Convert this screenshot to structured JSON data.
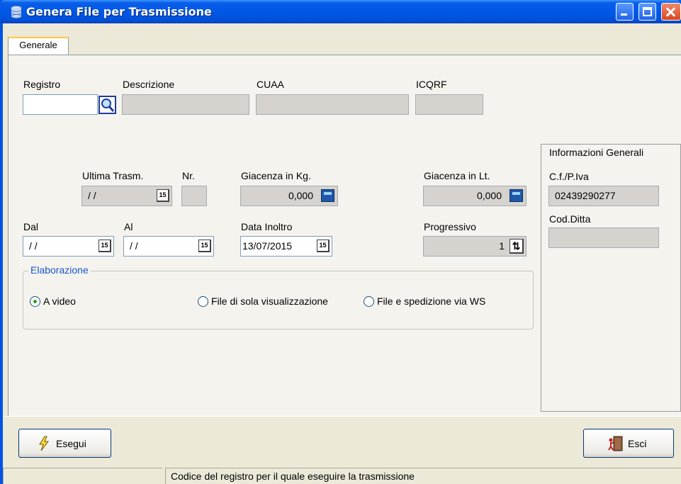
{
  "window": {
    "title": "Genera File per Trasmissione",
    "icon": "database-icon"
  },
  "titlebar": {
    "minimize_icon": "minimize-icon",
    "maximize_icon": "maximize-icon",
    "close_icon": "close-icon"
  },
  "tabs": [
    {
      "label": "Generale",
      "selected": true
    }
  ],
  "registro": {
    "label": "Registro",
    "value": "",
    "search_icon": "search-icon"
  },
  "descrizione": {
    "label": "Descrizione",
    "value": ""
  },
  "cuaa": {
    "label": "CUAA",
    "value": ""
  },
  "icqrf": {
    "label": "ICQRF",
    "value": ""
  },
  "ultima_trasm": {
    "label": "Ultima Trasm.",
    "value": " / /"
  },
  "nr": {
    "label": "Nr.",
    "value": ""
  },
  "giacenza_kg": {
    "label": "Giacenza in Kg.",
    "value": "0,000"
  },
  "giacenza_lt": {
    "label": "Giacenza in Lt.",
    "value": "0,000"
  },
  "dal": {
    "label": "Dal",
    "value": " / /"
  },
  "al": {
    "label": "Al",
    "value": " / /"
  },
  "data_inoltro": {
    "label": "Data Inoltro",
    "value": "13/07/2015"
  },
  "progressivo": {
    "label": "Progressivo",
    "value": "1"
  },
  "calendar_glyph": "15",
  "elaborazione": {
    "title": "Elaborazione",
    "options": [
      {
        "label": "A video",
        "checked": true
      },
      {
        "label": "File di sola visualizzazione",
        "checked": false
      },
      {
        "label": "File e spedizione via WS",
        "checked": false
      }
    ]
  },
  "info": {
    "title": "Informazioni Generali",
    "cf_label": "C.f./P.Iva",
    "cf_value": "02439290277",
    "cod_ditta_label": "Cod.Ditta",
    "cod_ditta_value": ""
  },
  "buttons": {
    "esegui": "Esegui",
    "esci": "Esci"
  },
  "statusbar": {
    "message": "Codice del registro per il quale eseguire la trasmissione"
  },
  "colors": {
    "titlebar": "#0058e6",
    "accent": "#1a56c7",
    "readonly_bg": "#d6d3ce"
  }
}
